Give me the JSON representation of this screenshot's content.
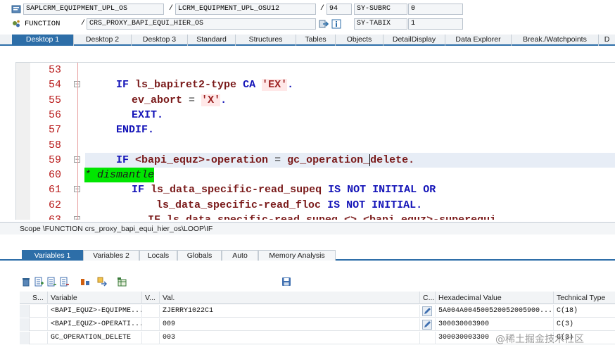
{
  "header": {
    "program": "SAPLCRM_EQUIPMENT_UPL_OS",
    "include": "LCRM_EQUIPMENT_UPL_OSU12",
    "line": "94",
    "subrc_label": "SY-SUBRC",
    "subrc_value": "0",
    "type_label": "FUNCTION",
    "function_name": "CRS_PROXY_BAPI_EQUI_HIER_OS",
    "tabix_label": "SY-TABIX",
    "tabix_value": "1",
    "slash": "/"
  },
  "desktop_tabs": [
    "Desktop 1",
    "Desktop 2",
    "Desktop 3",
    "Standard",
    "Structures",
    "Tables",
    "Objects",
    "DetailDisplay",
    "Data Explorer",
    "Break./Watchpoints",
    "D"
  ],
  "code": {
    "lines": [
      {
        "num": "53"
      },
      {
        "num": "54"
      },
      {
        "num": "55"
      },
      {
        "num": "56"
      },
      {
        "num": "57"
      },
      {
        "num": "58"
      },
      {
        "num": "59"
      },
      {
        "num": "60"
      },
      {
        "num": "61"
      },
      {
        "num": "62"
      },
      {
        "num": "63"
      }
    ],
    "t54_if": "IF",
    "t54_var": "ls_bapiret2-type",
    "t54_ca": "CA",
    "t54_str": "'EX'",
    "t54_dot": ".",
    "t55_var": "ev_abort",
    "t55_eq": "=",
    "t55_str": "'X'",
    "t55_dot": ".",
    "t56": "EXIT.",
    "t57": "ENDIF.",
    "t59_if": "IF",
    "t59_a": "<bapi_equz>-operation",
    "t59_eq": "=",
    "t59_b": "gc_operation_",
    "t59_c": "delete.",
    "t60": "* dismantle",
    "t61_if": "IF",
    "t61_var": "ls_data_specific-read_supeq",
    "t61_is": "IS",
    "t61_not": "NOT",
    "t61_init": "INITIAL",
    "t61_or": "OR",
    "t62_var": "ls_data_specific-read_floc",
    "t62_is": "IS",
    "t62_not": "NOT",
    "t62_init": "INITIAL.",
    "t63": "IF ls_data_specific-read_supeq <> <bapi_equz>-superequi"
  },
  "scope": "Scope \\FUNCTION crs_proxy_bapi_equi_hier_os\\LOOP\\IF",
  "var_tabs": [
    "Variables 1",
    "Variables 2",
    "Locals",
    "Globals",
    "Auto",
    "Memory Analysis"
  ],
  "table": {
    "headers": [
      "S...",
      "Variable",
      "V...",
      "Val.",
      "C...",
      "Hexadecimal Value",
      "Technical Type"
    ],
    "rows": [
      {
        "variable": "<BAPI_EQUZ>-EQUIPME...",
        "value": "ZJERRY1022C1",
        "hex": "5A004A004500520052005900...",
        "type": "C(18)"
      },
      {
        "variable": "<BAPI_EQUZ>-OPERATI...",
        "value": "009",
        "hex": "300030003900",
        "type": "C(3)"
      },
      {
        "variable": "GC_OPERATION_DELETE",
        "value": "003",
        "hex": "300030003300",
        "type": "C(3)"
      }
    ]
  },
  "watermark": "@稀土掘金技术社区",
  "colors": {
    "accent": "#2d6ea8",
    "line_numbers": "#b81a1a",
    "keyword": "#1414b8",
    "comment_bg": "#00e600"
  }
}
